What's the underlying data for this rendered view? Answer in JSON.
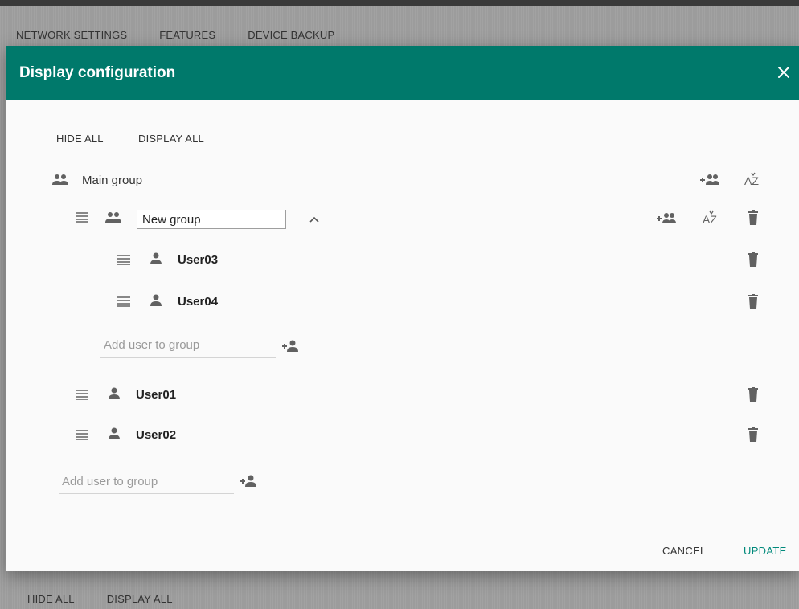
{
  "background": {
    "tabs": [
      "NETWORK SETTINGS",
      "FEATURES",
      "DEVICE BACKUP"
    ],
    "bottom_buttons": [
      "HIDE ALL",
      "DISPLAY ALL"
    ]
  },
  "dialog": {
    "title": "Display configuration",
    "hide_all": "HIDE ALL",
    "display_all": "DISPLAY ALL",
    "main_group": {
      "name": "Main group"
    },
    "sub_group": {
      "name_value": "New group",
      "users": [
        "User03",
        "User04"
      ],
      "add_user_placeholder": "Add user to group"
    },
    "main_users": [
      "User01",
      "User02"
    ],
    "main_add_user_placeholder": "Add user to group",
    "cancel_label": "CANCEL",
    "update_label": "UPDATE"
  },
  "colors": {
    "header": "#00796b",
    "accent": "#00897b",
    "icon": "#616161"
  },
  "icons": {
    "group": "group-icon",
    "person": "person-icon",
    "drag": "drag-handle-icon",
    "add_group": "add-group-icon",
    "sort": "sort-az-icon",
    "delete": "delete-icon",
    "add_user": "add-user-icon",
    "collapse": "chevron-up-icon",
    "close": "close-icon"
  }
}
